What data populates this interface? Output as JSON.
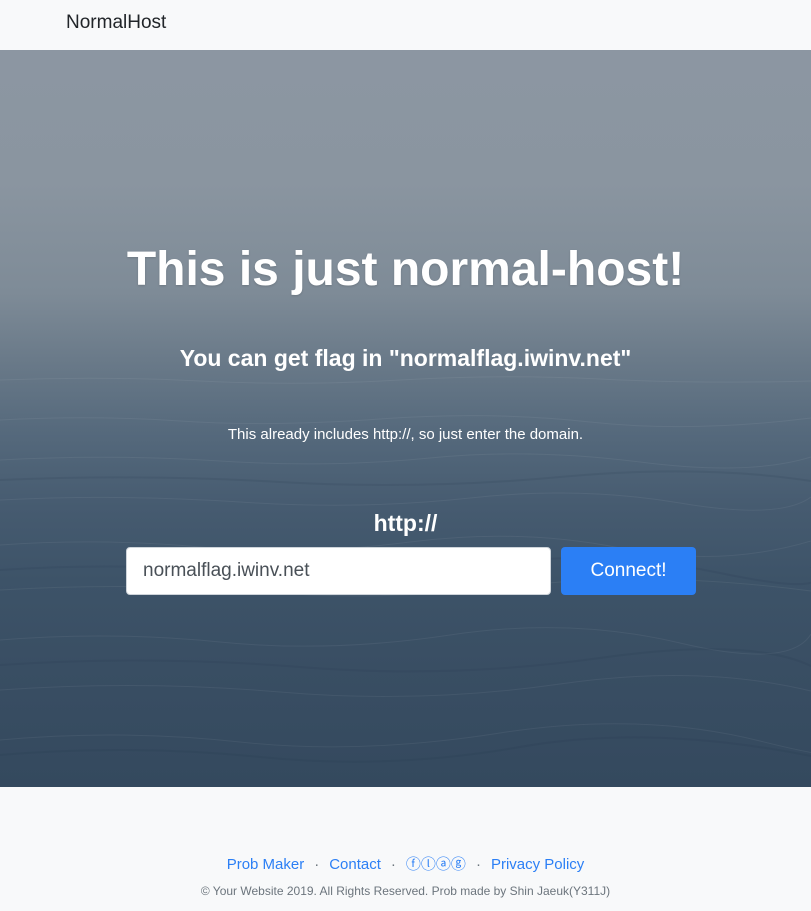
{
  "navbar": {
    "brand": "NormalHost"
  },
  "hero": {
    "title": "This is just normal-host!",
    "subtitle": "You can get flag in \"normalflag.iwinv.net\"",
    "note": "This already includes http://, so just enter the domain.",
    "protocol_label": "http://",
    "input_value": "normalflag.iwinv.net",
    "connect_label": "Connect!"
  },
  "footer": {
    "links": [
      {
        "label": "Prob Maker"
      },
      {
        "label": "Contact"
      },
      {
        "label": "ⓕⓛⓐⓖ"
      },
      {
        "label": "Privacy Policy"
      }
    ],
    "separator": "·",
    "copyright": "© Your Website 2019. All Rights Reserved. Prob made by Shin Jaeuk(Y311J)"
  },
  "colors": {
    "accent": "#2b7ff5",
    "sky_top": "#8c96a2",
    "sea_bottom": "#34495e",
    "footer_bg": "#f8f9fa"
  }
}
